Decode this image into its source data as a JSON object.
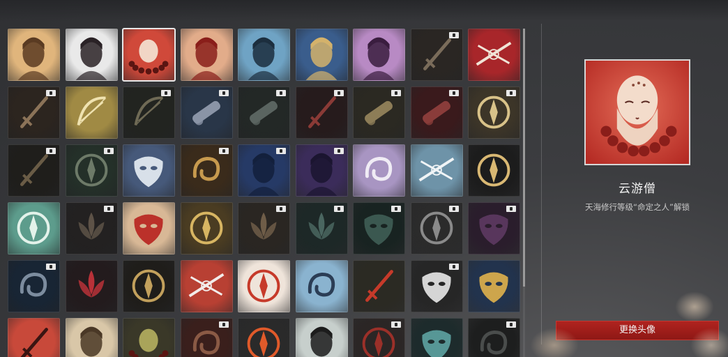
{
  "selected_avatar": {
    "name": "云游僧",
    "unlock_condition": "天海修行等级“命定之人”解锁"
  },
  "buttons": {
    "change_avatar": "更换头像"
  },
  "avatars": [
    {
      "icon": "young-man-portrait-icon",
      "bg": "#e0b57c",
      "fg": "#5a3b22",
      "locked": false,
      "shape": "face"
    },
    {
      "icon": "hooded-woman-portrait-icon",
      "bg": "#e9e9e9",
      "fg": "#2a2226",
      "locked": false,
      "shape": "face"
    },
    {
      "icon": "wandering-monk-portrait-icon",
      "bg": "#d0493a",
      "fg": "#f1d6c6",
      "locked": false,
      "shape": "monk",
      "selected": true
    },
    {
      "icon": "red-masked-woman-portrait-icon",
      "bg": "#e2ac8a",
      "fg": "#8a1e1a",
      "locked": false,
      "shape": "face"
    },
    {
      "icon": "blue-hair-girl-portrait-icon",
      "bg": "#6fa3c4",
      "fg": "#1c2e3e",
      "locked": false,
      "shape": "face"
    },
    {
      "icon": "golden-dragon-crown-portrait-icon",
      "bg": "#3a5d8c",
      "fg": "#d4b26b",
      "locked": false,
      "shape": "face"
    },
    {
      "icon": "purple-woman-portrait-icon",
      "bg": "#b88ac4",
      "fg": "#3a1d3f",
      "locked": false,
      "shape": "face"
    },
    {
      "icon": "dark-sword-emblem-icon",
      "bg": "#2a2623",
      "fg": "#7a6c5a",
      "locked": true,
      "shape": "sword"
    },
    {
      "icon": "crossed-swords-red-icon",
      "bg": "#a8262a",
      "fg": "#f0e4d6",
      "locked": false,
      "shape": "swords"
    },
    {
      "icon": "dagger-emblem-icon",
      "bg": "#2c251f",
      "fg": "#8b7358",
      "locked": true,
      "shape": "sword"
    },
    {
      "icon": "golden-bow-icon",
      "bg": "#a08a44",
      "fg": "#efe2b0",
      "locked": false,
      "shape": "bow"
    },
    {
      "icon": "crossbow-icon",
      "bg": "#222420",
      "fg": "#6f6a55",
      "locked": true,
      "shape": "bow"
    },
    {
      "icon": "cannon-blue-icon",
      "bg": "#293648",
      "fg": "#8a94a6",
      "locked": true,
      "shape": "cannon"
    },
    {
      "icon": "cannon-dark-icon",
      "bg": "#232826",
      "fg": "#5a6460",
      "locked": true,
      "shape": "cannon"
    },
    {
      "icon": "rifle-red-icon",
      "bg": "#261b1c",
      "fg": "#8a3a36",
      "locked": true,
      "shape": "sword"
    },
    {
      "icon": "launcher-gold-icon",
      "bg": "#2b2922",
      "fg": "#8d7d57",
      "locked": true,
      "shape": "cannon"
    },
    {
      "icon": "cannon-red-icon",
      "bg": "#3a1a1c",
      "fg": "#8a3c3a",
      "locked": true,
      "shape": "cannon"
    },
    {
      "icon": "golden-spear-emblem-icon",
      "bg": "#3c3528",
      "fg": "#d8c289",
      "locked": true,
      "shape": "ring"
    },
    {
      "icon": "dagger-shadow-icon",
      "bg": "#1f1e1b",
      "fg": "#6a5c46",
      "locked": true,
      "shape": "sword"
    },
    {
      "icon": "mace-emblem-icon",
      "bg": "#243029",
      "fg": "#6d7a68",
      "locked": true,
      "shape": "ring"
    },
    {
      "icon": "silver-dragon-mask-icon",
      "bg": "#46597a",
      "fg": "#e8eef5",
      "locked": false,
      "shape": "mask"
    },
    {
      "icon": "golden-dragon-icon",
      "bg": "#3a2b1b",
      "fg": "#c79a4e",
      "locked": true,
      "shape": "swirl"
    },
    {
      "icon": "blue-warrior-silhouette-icon",
      "bg": "#263a66",
      "fg": "#13203c",
      "locked": true,
      "shape": "face"
    },
    {
      "icon": "purple-woman-silhouette-icon",
      "bg": "#3b2c5a",
      "fg": "#1b1530",
      "locked": true,
      "shape": "face"
    },
    {
      "icon": "serpent-sword-icon",
      "bg": "#a895c2",
      "fg": "#f0ecf5",
      "locked": false,
      "shape": "swirl"
    },
    {
      "icon": "leaping-swordsman-icon",
      "bg": "#6e93a8",
      "fg": "#f0f4f6",
      "locked": false,
      "shape": "swords"
    },
    {
      "icon": "golden-vajra-icon",
      "bg": "#1c1c1c",
      "fg": "#d9b873",
      "locked": false,
      "shape": "ring"
    },
    {
      "icon": "jade-demon-ring-icon",
      "bg": "#5d9c8c",
      "fg": "#e3f2ea",
      "locked": false,
      "shape": "ring"
    },
    {
      "icon": "dark-lotus-emblem-icon",
      "bg": "#232121",
      "fg": "#5d5247",
      "locked": true,
      "shape": "lotus"
    },
    {
      "icon": "red-seal-lantern-icon",
      "bg": "#d8b896",
      "fg": "#b8221e",
      "locked": false,
      "shape": "mask"
    },
    {
      "icon": "golden-tiger-crest-icon",
      "bg": "#4a3c22",
      "fg": "#d7b562",
      "locked": false,
      "shape": "ring"
    },
    {
      "icon": "eagle-crest-icon",
      "bg": "#2a2622",
      "fg": "#6f5d48",
      "locked": true,
      "shape": "lotus"
    },
    {
      "icon": "teal-lotus-emblem-icon",
      "bg": "#1d2827",
      "fg": "#4a6660",
      "locked": true,
      "shape": "lotus"
    },
    {
      "icon": "teal-mask-emblem-icon",
      "bg": "#182321",
      "fg": "#3f5e55",
      "locked": true,
      "shape": "mask"
    },
    {
      "icon": "hexagon-seal-icon",
      "bg": "#2b2b2b",
      "fg": "#8a8a8a",
      "locked": true,
      "shape": "ring"
    },
    {
      "icon": "purple-demon-mask-icon",
      "bg": "#2a1d2c",
      "fg": "#5d3a62",
      "locked": true,
      "shape": "mask"
    },
    {
      "icon": "cloud-swirl-icon",
      "bg": "#182534",
      "fg": "#7c8c9e",
      "locked": true,
      "shape": "swirl"
    },
    {
      "icon": "red-lotus-icon",
      "bg": "#231b1d",
      "fg": "#b83138",
      "locked": false,
      "shape": "lotus"
    },
    {
      "icon": "golden-trident-icon",
      "bg": "#1f1d1a",
      "fg": "#c2a05c",
      "locked": false,
      "shape": "ring"
    },
    {
      "icon": "paper-crane-icon",
      "bg": "#b84033",
      "fg": "#f2ecea",
      "locked": false,
      "shape": "swords"
    },
    {
      "icon": "red-umbrella-icon",
      "bg": "#efe4da",
      "fg": "#c63a2a",
      "locked": false,
      "shape": "ring"
    },
    {
      "icon": "gourd-waves-icon",
      "bg": "#8ab3cf",
      "fg": "#2b3d55",
      "locked": false,
      "shape": "swirl"
    },
    {
      "icon": "red-coin-charm-icon",
      "bg": "#2b2a23",
      "fg": "#c63a2a",
      "locked": false,
      "shape": "sword"
    },
    {
      "icon": "half-skull-mask-icon",
      "bg": "#262626",
      "fg": "#e9e9e9",
      "locked": true,
      "shape": "mask"
    },
    {
      "icon": "golden-masquerade-mask-icon",
      "bg": "#22334d",
      "fg": "#e0b14c",
      "locked": false,
      "shape": "mask"
    },
    {
      "icon": "red-flute-icon",
      "bg": "#c8493a",
      "fg": "#3a1512",
      "locked": false,
      "shape": "sword"
    },
    {
      "icon": "fox-figure-icon",
      "bg": "#d9c7a8",
      "fg": "#4a3826",
      "locked": false,
      "shape": "face"
    },
    {
      "icon": "jade-buddha-icon",
      "bg": "#3a3828",
      "fg": "#a9a45a",
      "locked": false,
      "shape": "monk"
    },
    {
      "icon": "golden-toad-icon",
      "bg": "#3a1f1c",
      "fg": "#8a5a45",
      "locked": true,
      "shape": "swirl"
    },
    {
      "icon": "red-lantern-icon",
      "bg": "#2a2a2a",
      "fg": "#e05a2a",
      "locked": false,
      "shape": "ring"
    },
    {
      "icon": "panda-icon",
      "bg": "#c7cfcc",
      "fg": "#1c1c1c",
      "locked": false,
      "shape": "face"
    },
    {
      "icon": "red-cat-lantern-icon",
      "bg": "#2b2625",
      "fg": "#9b3029",
      "locked": true,
      "shape": "ring"
    },
    {
      "icon": "teal-tiger-icon",
      "bg": "#1d2b2c",
      "fg": "#5ea3a2",
      "locked": false,
      "shape": "mask"
    },
    {
      "icon": "dark-feather-icon",
      "bg": "#1d1e1e",
      "fg": "#4a4d4c",
      "locked": true,
      "shape": "swirl"
    }
  ]
}
